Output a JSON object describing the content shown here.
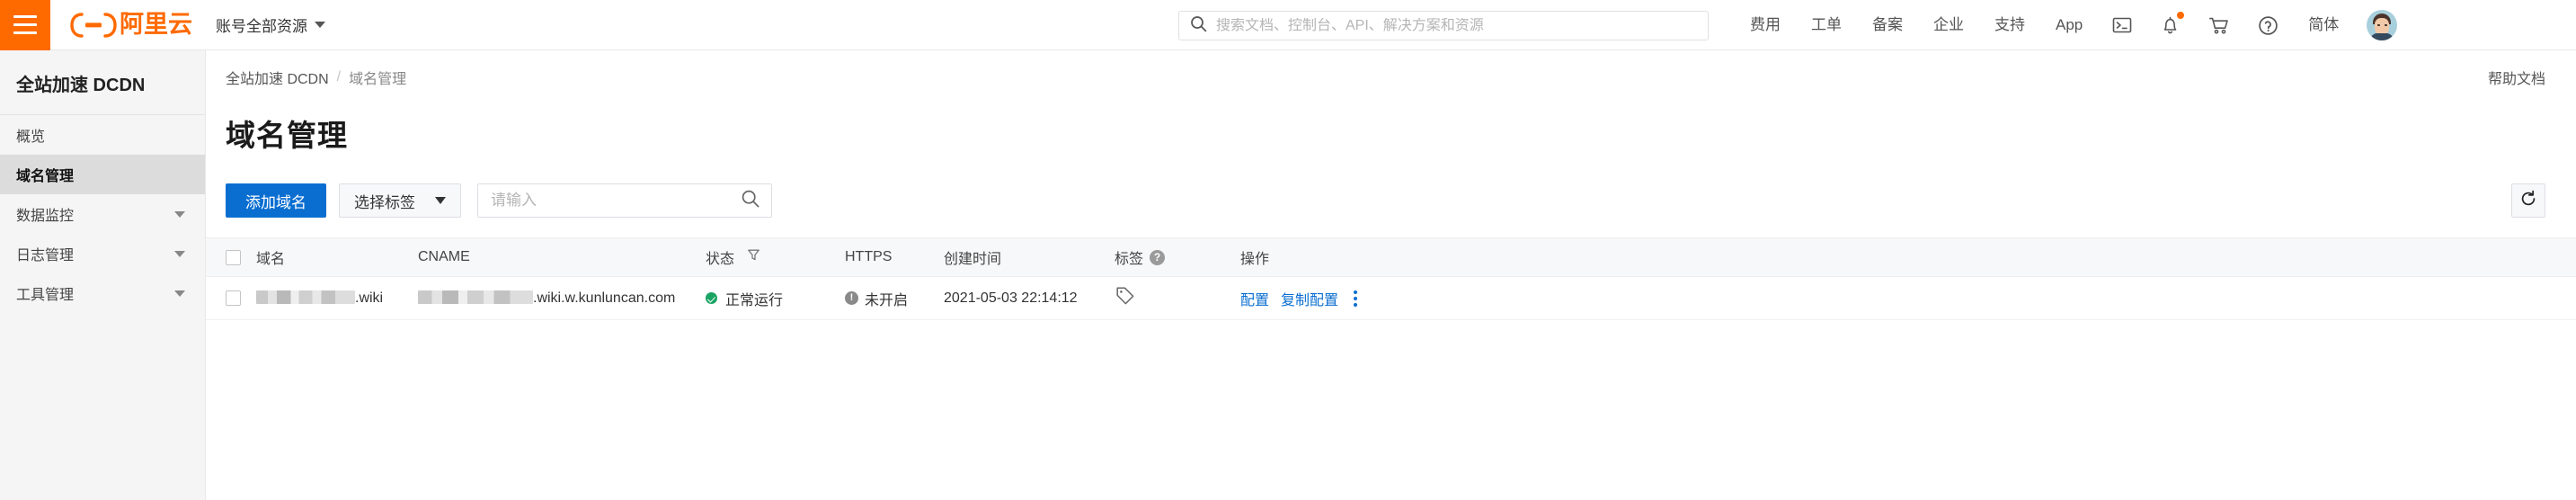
{
  "topbar": {
    "menu_icon": "hamburger-menu-icon",
    "logo_text": "阿里云",
    "account_switcher": "账号全部资源",
    "search": {
      "placeholder": "搜索文档、控制台、API、解决方案和资源",
      "value": "",
      "icon": "search-icon"
    },
    "nav_items": [
      {
        "label": "费用",
        "name": "nav-billing"
      },
      {
        "label": "工单",
        "name": "nav-tickets"
      },
      {
        "label": "备案",
        "name": "nav-icp"
      },
      {
        "label": "企业",
        "name": "nav-enterprise"
      },
      {
        "label": "支持",
        "name": "nav-support"
      },
      {
        "label": "App",
        "name": "nav-app"
      }
    ],
    "icons": [
      {
        "name": "terminal-icon",
        "badge": false
      },
      {
        "name": "bell-icon",
        "badge": true
      },
      {
        "name": "cart-icon",
        "badge": false
      },
      {
        "name": "help-circle-icon",
        "badge": false
      }
    ],
    "language": "简体",
    "avatar": "user-avatar"
  },
  "sidebar": {
    "title": "全站加速 DCDN",
    "items": [
      {
        "label": "概览",
        "active": false,
        "expandable": false
      },
      {
        "label": "域名管理",
        "active": true,
        "expandable": false
      },
      {
        "label": "数据监控",
        "active": false,
        "expandable": true
      },
      {
        "label": "日志管理",
        "active": false,
        "expandable": true
      },
      {
        "label": "工具管理",
        "active": false,
        "expandable": true
      }
    ]
  },
  "breadcrumb": {
    "root": "全站加速 DCDN",
    "separator": "/",
    "current": "域名管理"
  },
  "help_doc_label": "帮助文档",
  "page_title": "域名管理",
  "toolbar": {
    "add_domain_label": "添加域名",
    "select_tag_label": "选择标签",
    "filter_placeholder": "请输入",
    "filter_value": "",
    "refresh_icon": "refresh-icon",
    "search_icon": "search-icon"
  },
  "table": {
    "columns": [
      {
        "key": "checkbox",
        "label": "",
        "name": "select-all-checkbox"
      },
      {
        "key": "domain",
        "label": "域名",
        "name": "column-domain"
      },
      {
        "key": "cname",
        "label": "CNAME",
        "name": "column-cname"
      },
      {
        "key": "status",
        "label": "状态",
        "name": "column-status",
        "icon": "filter-icon"
      },
      {
        "key": "https",
        "label": "HTTPS",
        "name": "column-https"
      },
      {
        "key": "created",
        "label": "创建时间",
        "name": "column-created-time"
      },
      {
        "key": "tags",
        "label": "标签",
        "name": "column-tags",
        "icon": "help-circle-icon"
      },
      {
        "key": "actions",
        "label": "操作",
        "name": "column-actions"
      }
    ],
    "rows": [
      {
        "domain_suffix": ".wiki",
        "domain_redacted": true,
        "cname_suffix": ".wiki.w.kunluncan.com",
        "cname_redacted": true,
        "status": "正常运行",
        "status_type": "ok",
        "https": "未开启",
        "https_type": "warn",
        "created": "2021-05-03 22:14:12",
        "tag_icon": "tag-icon",
        "actions": [
          {
            "label": "配置",
            "name": "action-configure"
          },
          {
            "label": "复制配置",
            "name": "action-copy-config"
          }
        ],
        "more_icon": "kebab-menu-icon"
      }
    ]
  },
  "colors": {
    "brand_orange": "#ff6a00",
    "primary_blue": "#0a6ed1",
    "status_green": "#19a463",
    "status_gray": "#8a8a8a"
  }
}
